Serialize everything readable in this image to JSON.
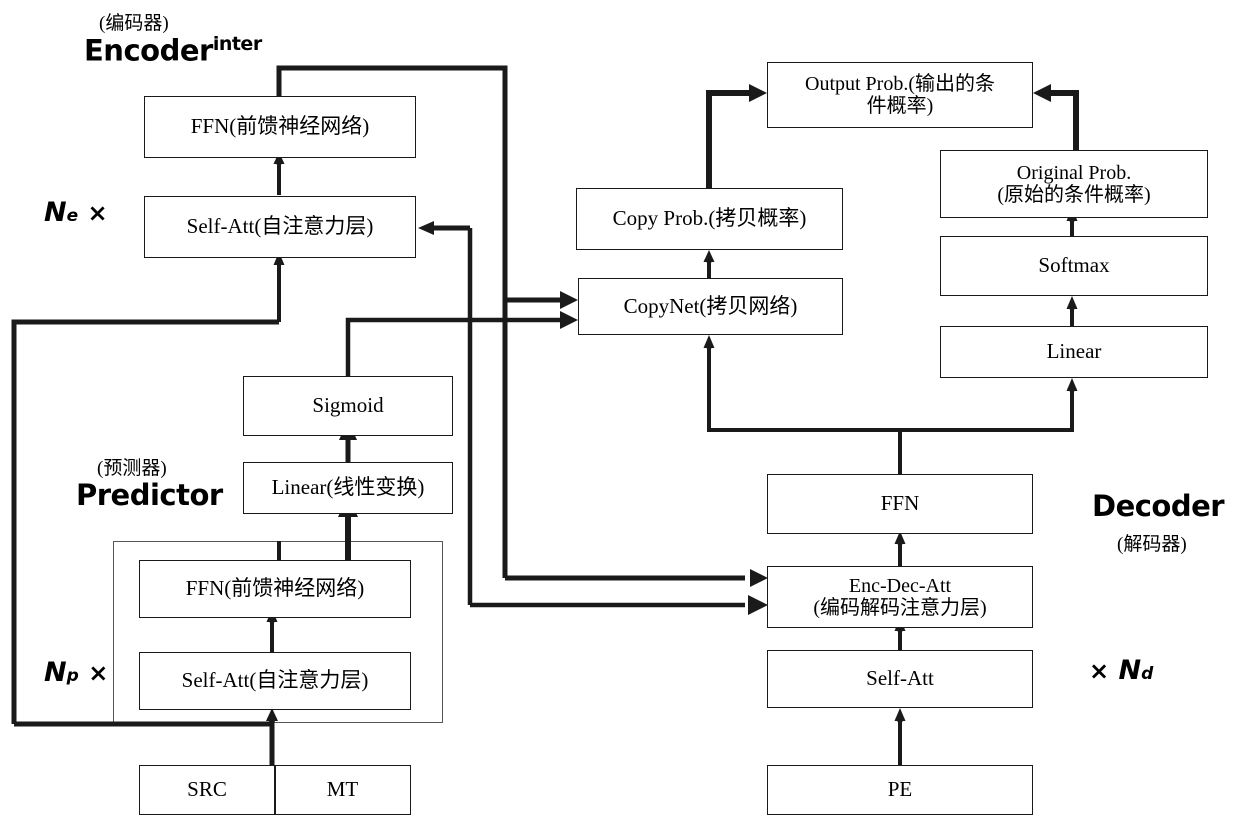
{
  "figure": {
    "title_note": "Transformer-based APE model with predictor, encoder and decoder with CopyNet"
  },
  "labels": {
    "encoder_cn": "(编码器)",
    "encoder_en": "Encoder",
    "encoder_sup": "inter",
    "predictor_cn": "(预测器)",
    "predictor_en": "Predictor",
    "decoder_en": "Decoder",
    "decoder_cn": "(解码器)",
    "ne": "N",
    "ne_sub": "e",
    "np": "N",
    "np_sub": "p",
    "nd": "N",
    "nd_sub": "d",
    "times": "×"
  },
  "encoder": {
    "ffn": "FFN(前馈神经网络)",
    "self_att": "Self-Att(自注意力层)"
  },
  "predictor": {
    "sigmoid": "Sigmoid",
    "linear": "Linear(线性变换)",
    "ffn": "FFN(前馈神经网络)",
    "self_att": "Self-Att(自注意力层)",
    "src": "SRC",
    "mt": "MT"
  },
  "copy": {
    "copy_prob": "Copy Prob.(拷贝概率)",
    "copynet": "CopyNet(拷贝网络)"
  },
  "output": {
    "output_prob_line1": "Output Prob.(输出的条",
    "output_prob_line2": "件概率)",
    "original_prob_line1": "Original Prob.",
    "original_prob_line2": "(原始的条件概率)",
    "softmax": "Softmax",
    "linear": "Linear"
  },
  "decoder": {
    "ffn": "FFN",
    "enc_dec_att_line1": "Enc-Dec-Att",
    "enc_dec_att_line2": "(编码解码注意力层)",
    "self_att": "Self-Att",
    "pe": "PE"
  },
  "colors": {
    "stroke": "#1a1a1a",
    "box_border": "#1a1a1a",
    "group_border": "#555555",
    "background": "#ffffff"
  }
}
